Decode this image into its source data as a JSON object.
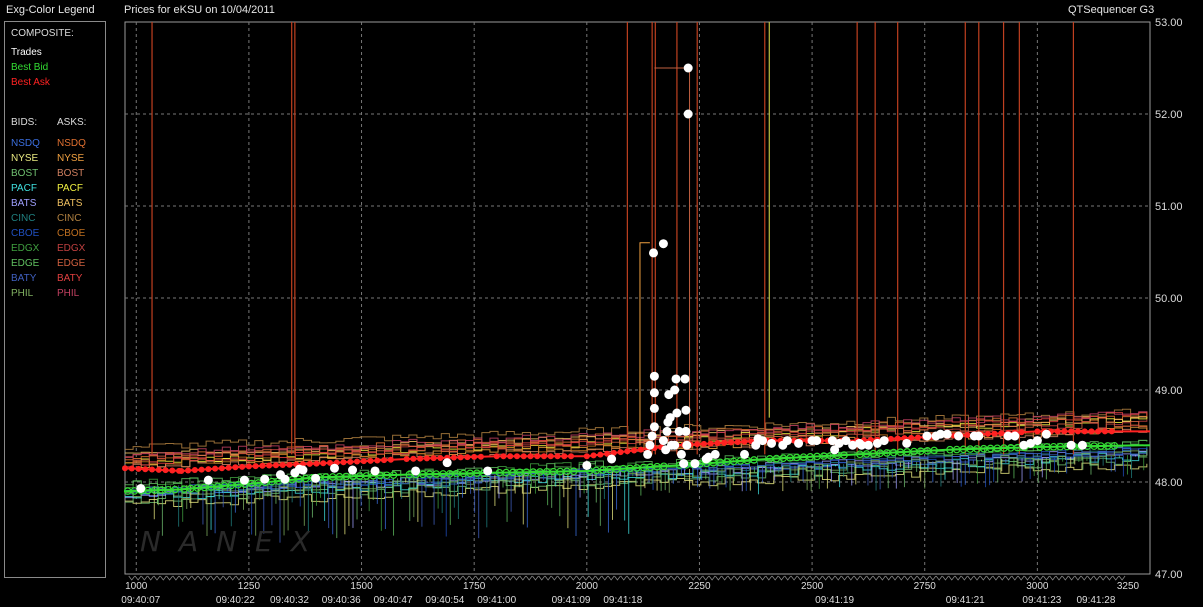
{
  "header": {
    "legend_title": "Exg-Color Legend",
    "chart_title": "Prices for  eKSU  on  10/04/2011",
    "app_name": "QTSequencer G3"
  },
  "legend": {
    "composite_label": "COMPOSITE:",
    "composite": [
      {
        "label": "Trades",
        "color": "#ffffff"
      },
      {
        "label": "Best Bid",
        "color": "#33dd33"
      },
      {
        "label": "Best Ask",
        "color": "#ff2222"
      }
    ],
    "bids_label": "BIDS:",
    "asks_label": "ASKS:",
    "exchanges": [
      {
        "bid": "NSDQ",
        "bid_color": "#3b6fe0",
        "ask": "NSDQ",
        "ask_color": "#e07030"
      },
      {
        "bid": "NYSE",
        "bid_color": "#e8e880",
        "ask": "NYSE",
        "ask_color": "#f0a040"
      },
      {
        "bid": "BOST",
        "bid_color": "#70c070",
        "ask": "BOST",
        "ask_color": "#d08060"
      },
      {
        "bid": "PACF",
        "bid_color": "#40e0e0",
        "ask": "PACF",
        "ask_color": "#f0f040"
      },
      {
        "bid": "BATS",
        "bid_color": "#a0a0ff",
        "ask": "BATS",
        "ask_color": "#f0c060"
      },
      {
        "bid": "CINC",
        "bid_color": "#208080",
        "ask": "CINC",
        "ask_color": "#b08040"
      },
      {
        "bid": "CBOE",
        "bid_color": "#2050c0",
        "ask": "CBOE",
        "ask_color": "#c07020"
      },
      {
        "bid": "EDGX",
        "bid_color": "#40a040",
        "ask": "EDGX",
        "ask_color": "#c04040"
      },
      {
        "bid": "EDGE",
        "bid_color": "#60c060",
        "ask": "EDGE",
        "ask_color": "#d06040"
      },
      {
        "bid": "BATY",
        "bid_color": "#4060c0",
        "ask": "BATY",
        "ask_color": "#e04040"
      },
      {
        "bid": "PHIL",
        "bid_color": "#80b060",
        "ask": "PHIL",
        "ask_color": "#c04060"
      }
    ]
  },
  "chart_data": {
    "type": "line",
    "grid": true,
    "y_ticks": [
      "47.00",
      "48.00",
      "49.00",
      "50.00",
      "51.00",
      "52.00",
      "53.00"
    ],
    "ylim": [
      47,
      53
    ],
    "xlim": [
      975,
      3250
    ],
    "x_ticks": [
      "1000",
      "1250",
      "1500",
      "1750",
      "2000",
      "2250",
      "2500",
      "2750",
      "3000",
      "3250"
    ],
    "time_labels": [
      {
        "seq": 1010,
        "label": "09:40:07"
      },
      {
        "seq": 1220,
        "label": "09:40:22"
      },
      {
        "seq": 1340,
        "label": "09:40:32"
      },
      {
        "seq": 1455,
        "label": "09:40:36"
      },
      {
        "seq": 1570,
        "label": "09:40:47"
      },
      {
        "seq": 1685,
        "label": "09:40:54"
      },
      {
        "seq": 1800,
        "label": "09:41:00"
      },
      {
        "seq": 1965,
        "label": "09:41:09"
      },
      {
        "seq": 2080,
        "label": "09:41:18"
      },
      {
        "seq": 2550,
        "label": "09:41:19"
      },
      {
        "seq": 2840,
        "label": "09:41:21"
      },
      {
        "seq": 3010,
        "label": "09:41:23"
      },
      {
        "seq": 3130,
        "label": "09:41:28"
      }
    ],
    "trades": [
      {
        "x": 1010,
        "y": 47.93
      },
      {
        "x": 1160,
        "y": 48.02
      },
      {
        "x": 1240,
        "y": 48.02
      },
      {
        "x": 1285,
        "y": 48.03
      },
      {
        "x": 1320,
        "y": 48.08
      },
      {
        "x": 1330,
        "y": 48.03
      },
      {
        "x": 1352,
        "y": 48.1
      },
      {
        "x": 1362,
        "y": 48.14
      },
      {
        "x": 1370,
        "y": 48.13
      },
      {
        "x": 1398,
        "y": 48.04
      },
      {
        "x": 1440,
        "y": 48.15
      },
      {
        "x": 1480,
        "y": 48.13
      },
      {
        "x": 1530,
        "y": 48.12
      },
      {
        "x": 1620,
        "y": 48.12
      },
      {
        "x": 1690,
        "y": 48.21
      },
      {
        "x": 1780,
        "y": 48.12
      },
      {
        "x": 2000,
        "y": 48.18
      },
      {
        "x": 2055,
        "y": 48.25
      },
      {
        "x": 2135,
        "y": 48.3
      },
      {
        "x": 2140,
        "y": 48.4
      },
      {
        "x": 2145,
        "y": 48.5
      },
      {
        "x": 2150,
        "y": 48.6
      },
      {
        "x": 2150,
        "y": 48.8
      },
      {
        "x": 2150,
        "y": 48.97
      },
      {
        "x": 2150,
        "y": 49.15
      },
      {
        "x": 2148,
        "y": 50.49
      },
      {
        "x": 2170,
        "y": 50.59
      },
      {
        "x": 2170,
        "y": 48.45
      },
      {
        "x": 2175,
        "y": 48.35
      },
      {
        "x": 2178,
        "y": 48.55
      },
      {
        "x": 2180,
        "y": 48.65
      },
      {
        "x": 2182,
        "y": 48.95
      },
      {
        "x": 2185,
        "y": 48.7
      },
      {
        "x": 2188,
        "y": 48.4
      },
      {
        "x": 2195,
        "y": 48.4
      },
      {
        "x": 2195,
        "y": 49.0
      },
      {
        "x": 2198,
        "y": 49.12
      },
      {
        "x": 2200,
        "y": 48.75
      },
      {
        "x": 2205,
        "y": 48.55
      },
      {
        "x": 2210,
        "y": 48.3
      },
      {
        "x": 2215,
        "y": 48.2
      },
      {
        "x": 2218,
        "y": 49.12
      },
      {
        "x": 2220,
        "y": 48.78
      },
      {
        "x": 2220,
        "y": 48.55
      },
      {
        "x": 2222,
        "y": 48.4
      },
      {
        "x": 2225,
        "y": 52.0
      },
      {
        "x": 2225,
        "y": 52.5
      },
      {
        "x": 2240,
        "y": 48.2
      },
      {
        "x": 2265,
        "y": 48.25
      },
      {
        "x": 2270,
        "y": 48.27
      },
      {
        "x": 2285,
        "y": 48.3
      },
      {
        "x": 2350,
        "y": 48.3
      },
      {
        "x": 2375,
        "y": 48.4
      },
      {
        "x": 2380,
        "y": 48.47
      },
      {
        "x": 2390,
        "y": 48.45
      },
      {
        "x": 2410,
        "y": 48.42
      },
      {
        "x": 2435,
        "y": 48.4
      },
      {
        "x": 2445,
        "y": 48.45
      },
      {
        "x": 2470,
        "y": 48.42
      },
      {
        "x": 2500,
        "y": 48.45
      },
      {
        "x": 2510,
        "y": 48.45
      },
      {
        "x": 2545,
        "y": 48.45
      },
      {
        "x": 2550,
        "y": 48.35
      },
      {
        "x": 2560,
        "y": 48.42
      },
      {
        "x": 2575,
        "y": 48.45
      },
      {
        "x": 2590,
        "y": 48.4
      },
      {
        "x": 2605,
        "y": 48.42
      },
      {
        "x": 2610,
        "y": 48.4
      },
      {
        "x": 2625,
        "y": 48.4
      },
      {
        "x": 2645,
        "y": 48.42
      },
      {
        "x": 2660,
        "y": 48.45
      },
      {
        "x": 2710,
        "y": 48.42
      },
      {
        "x": 2755,
        "y": 48.5
      },
      {
        "x": 2775,
        "y": 48.5
      },
      {
        "x": 2785,
        "y": 48.52
      },
      {
        "x": 2800,
        "y": 48.52
      },
      {
        "x": 2825,
        "y": 48.5
      },
      {
        "x": 2860,
        "y": 48.5
      },
      {
        "x": 2870,
        "y": 48.5
      },
      {
        "x": 2935,
        "y": 48.5
      },
      {
        "x": 2950,
        "y": 48.5
      },
      {
        "x": 2970,
        "y": 48.4
      },
      {
        "x": 2985,
        "y": 48.42
      },
      {
        "x": 3000,
        "y": 48.45
      },
      {
        "x": 3020,
        "y": 48.52
      },
      {
        "x": 3075,
        "y": 48.4
      },
      {
        "x": 3100,
        "y": 48.4
      }
    ],
    "best_bid": [
      [
        975,
        47.9
      ],
      [
        1100,
        47.92
      ],
      [
        1250,
        47.98
      ],
      [
        1400,
        48.05
      ],
      [
        1600,
        48.08
      ],
      [
        1800,
        48.1
      ],
      [
        2000,
        48.12
      ],
      [
        2200,
        48.18
      ],
      [
        2400,
        48.25
      ],
      [
        2600,
        48.3
      ],
      [
        2800,
        48.35
      ],
      [
        3000,
        48.38
      ],
      [
        3250,
        48.4
      ]
    ],
    "best_ask": [
      [
        975,
        48.15
      ],
      [
        1100,
        48.12
      ],
      [
        1250,
        48.17
      ],
      [
        1400,
        48.2
      ],
      [
        1600,
        48.25
      ],
      [
        1800,
        48.28
      ],
      [
        2000,
        48.28
      ],
      [
        2200,
        48.4
      ],
      [
        2400,
        48.45
      ],
      [
        2600,
        48.45
      ],
      [
        2800,
        48.5
      ],
      [
        3000,
        48.55
      ],
      [
        3250,
        48.55
      ]
    ]
  }
}
